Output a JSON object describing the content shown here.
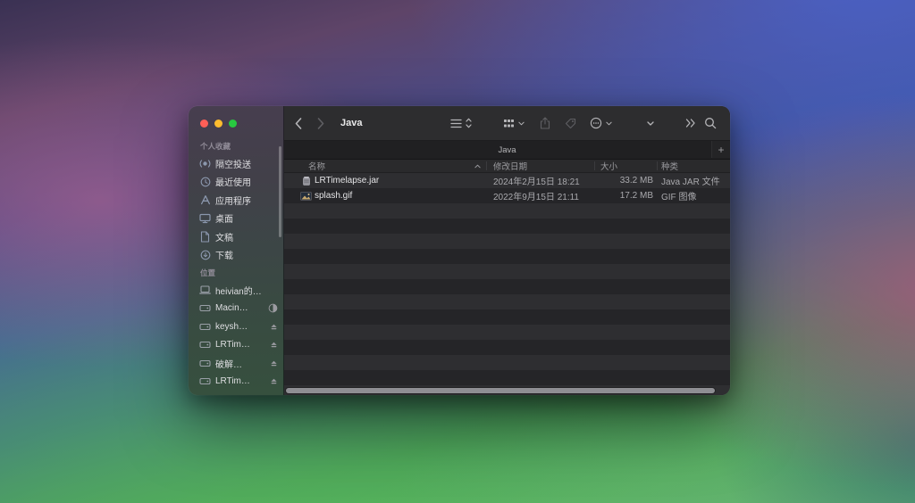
{
  "colors": {
    "close_button": "#ff5f57",
    "minimize_button": "#febc2e",
    "zoom_button": "#28c840",
    "window_bg": "#262628",
    "stripe_light": "#2e2e31",
    "stripe_dark": "#252528",
    "sidebar_icon": "#8b97ad"
  },
  "window": {
    "title": "Java",
    "toolbar": {
      "icons": [
        "back",
        "forward",
        "view-as-list",
        "view-updown",
        "group-by",
        "share",
        "tags",
        "more-actions",
        "actions-chevron",
        "overflow",
        "search"
      ]
    },
    "tab_bar": {
      "tab_label": "Java",
      "new_tab_label": "+"
    },
    "columns": {
      "name": "名称",
      "date_modified": "修改日期",
      "size": "大小",
      "kind": "种类"
    },
    "files": [
      {
        "name": "LRTimelapse.jar",
        "date_modified": "2024年2月15日 18:21",
        "size": "33.2 MB",
        "kind": "Java JAR 文件",
        "icon": "jar-file-icon"
      },
      {
        "name": "splash.gif",
        "date_modified": "2022年9月15日 21:11",
        "size": "17.2 MB",
        "kind": "GIF 图像",
        "icon": "gif-image-icon"
      }
    ]
  },
  "sidebar": {
    "sections": [
      {
        "title": "个人收藏",
        "items": [
          {
            "label": "隔空投送",
            "icon": "airdrop-icon"
          },
          {
            "label": "最近使用",
            "icon": "clock-icon"
          },
          {
            "label": "应用程序",
            "icon": "applications-icon"
          },
          {
            "label": "桌面",
            "icon": "desktop-icon"
          },
          {
            "label": "文稿",
            "icon": "document-icon"
          },
          {
            "label": "下载",
            "icon": "download-icon"
          }
        ]
      },
      {
        "title": "位置",
        "items": [
          {
            "label": "heivian的…",
            "icon": "laptop-icon",
            "accessory": "none"
          },
          {
            "label": "Macin…",
            "icon": "disk-icon",
            "accessory": "storage-indicator"
          },
          {
            "label": "keysh…",
            "icon": "disk-icon",
            "accessory": "eject"
          },
          {
            "label": "LRTim…",
            "icon": "disk-icon",
            "accessory": "eject"
          },
          {
            "label": "破解…",
            "icon": "disk-icon",
            "accessory": "eject"
          },
          {
            "label": "LRTim…",
            "icon": "disk-icon",
            "accessory": "eject"
          }
        ]
      }
    ]
  }
}
